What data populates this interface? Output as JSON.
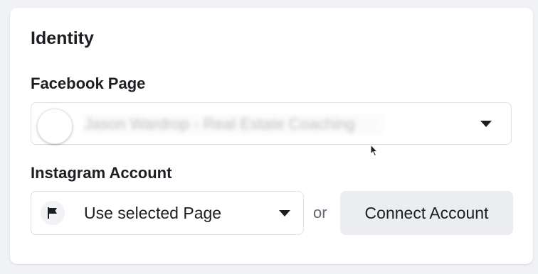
{
  "identity": {
    "title": "Identity",
    "facebook_page": {
      "label": "Facebook Page",
      "selected_value": "Jason Wardrop - Real Estate Coaching",
      "icon": "chevron-down-icon"
    },
    "instagram_account": {
      "label": "Instagram Account",
      "selected_value": "Use selected Page",
      "flag_icon": "flag-icon",
      "separator": "or",
      "connect_label": "Connect Account"
    }
  },
  "colors": {
    "background": "#f0f2f5",
    "card": "#ffffff",
    "text": "#1c1e21",
    "border": "#dddfe2",
    "button": "#ebedf0"
  }
}
